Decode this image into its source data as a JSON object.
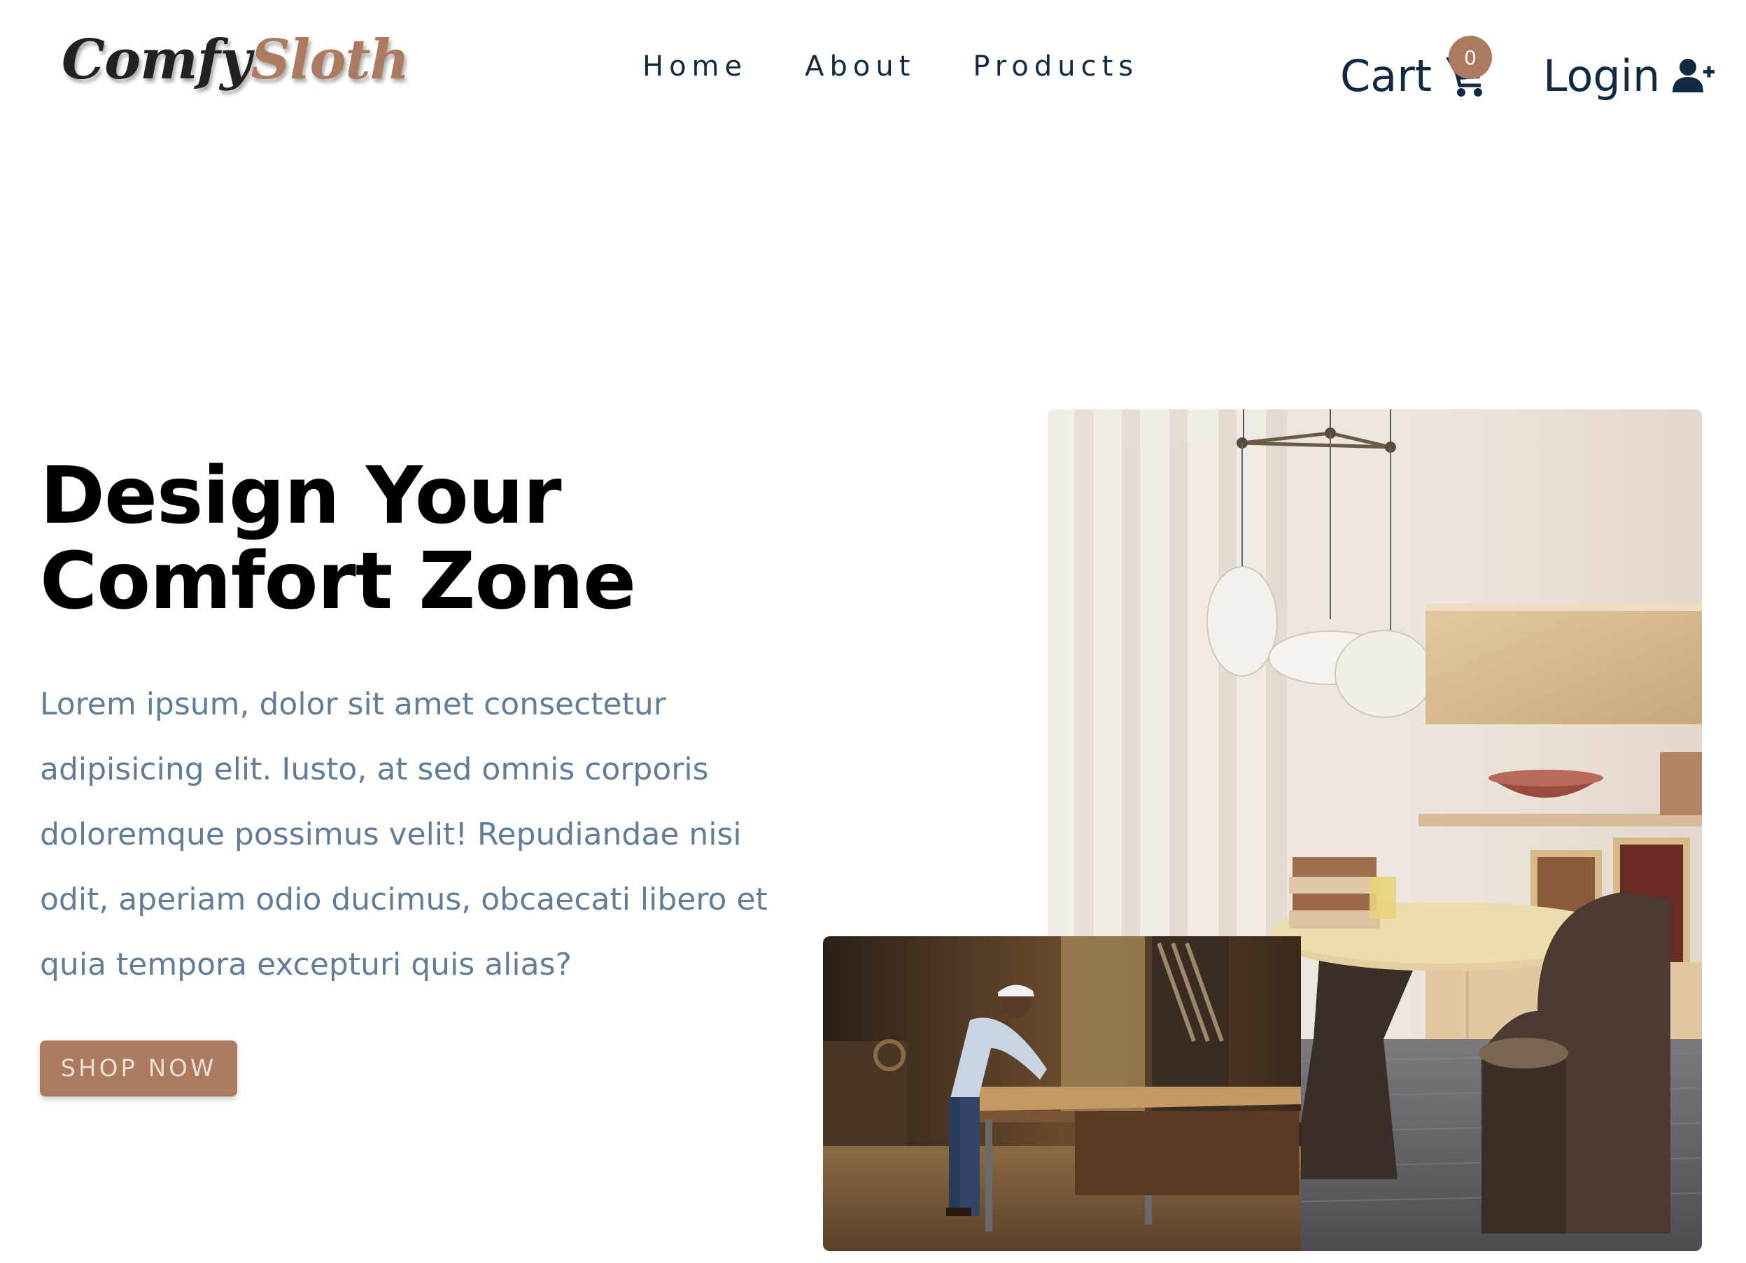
{
  "brand": {
    "logo_part1": "Comfy",
    "logo_part2": "Sloth",
    "accent_color": "#ab7a5f"
  },
  "nav": {
    "links": [
      {
        "label": "Home"
      },
      {
        "label": "About"
      },
      {
        "label": "Products"
      }
    ]
  },
  "cart": {
    "label": "Cart",
    "count": "0",
    "icon": "cart-icon"
  },
  "login": {
    "label": "Login",
    "icon": "user-plus-icon"
  },
  "hero": {
    "title_line1": "Design Your",
    "title_line2": "Comfort Zone",
    "description": "Lorem ipsum, dolor sit amet consectetur adipisicing elit. Iusto, at sed omnis corporis doloremque possimus velit! Repudiandae nisi odit, aperiam odio ducimus, obcaecati libero et quia tempora excepturi quis alias?",
    "cta_label": "SHOP NOW"
  },
  "images": {
    "main": "dining-room-with-pendant-lamps",
    "accent": "carpenter-at-workbench"
  }
}
